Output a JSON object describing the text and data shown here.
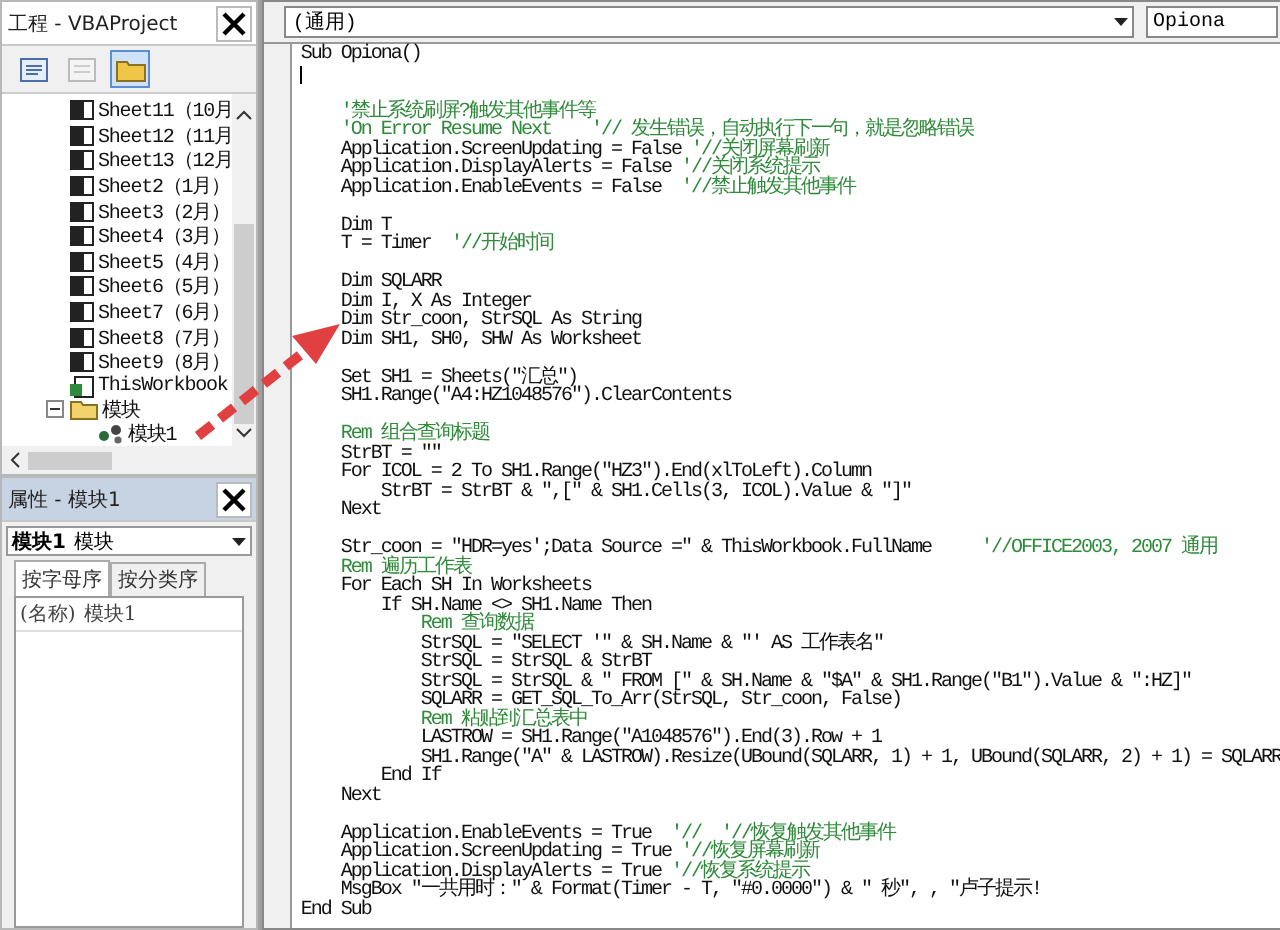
{
  "project_pane": {
    "title": "工程 - VBAProject",
    "toolbar": [
      {
        "kind": "view-code",
        "selected": false
      },
      {
        "kind": "view-object",
        "selected": false
      },
      {
        "kind": "toggle-folders",
        "selected": true
      }
    ],
    "tree": [
      {
        "kind": "sheet",
        "label": "Sheet11（10月"
      },
      {
        "kind": "sheet",
        "label": "Sheet12（11月"
      },
      {
        "kind": "sheet",
        "label": "Sheet13（12月"
      },
      {
        "kind": "sheet",
        "label": "Sheet2（1月）"
      },
      {
        "kind": "sheet",
        "label": "Sheet3（2月）"
      },
      {
        "kind": "sheet",
        "label": "Sheet4（3月）"
      },
      {
        "kind": "sheet",
        "label": "Sheet5（4月）"
      },
      {
        "kind": "sheet",
        "label": "Sheet6（5月）"
      },
      {
        "kind": "sheet",
        "label": "Sheet7（6月）"
      },
      {
        "kind": "sheet",
        "label": "Sheet8（7月）"
      },
      {
        "kind": "sheet",
        "label": "Sheet9（8月）"
      },
      {
        "kind": "workbook",
        "label": "ThisWorkbook"
      },
      {
        "kind": "folder",
        "label": "模块",
        "expanded": true,
        "children": [
          {
            "kind": "module",
            "label": "模块1"
          }
        ]
      }
    ]
  },
  "properties_pane": {
    "title": "属性 - 模块1",
    "object_name": "模块1",
    "object_type": "模块",
    "tabs": [
      {
        "label": "按字母序",
        "selected": true
      },
      {
        "label": "按分类序",
        "selected": false
      }
    ],
    "rows": [
      {
        "name": "(名称)",
        "value": "模块1"
      }
    ]
  },
  "code_window": {
    "object_combo": "(通用)",
    "procedure_combo": "Opiona",
    "lines": [
      {
        "kind": "text",
        "code": "Sub Opiona()"
      },
      {
        "kind": "cursor"
      },
      {
        "kind": "blank"
      },
      {
        "kind": "text",
        "comment": "    '禁止系统刷屏?触发其他事件等"
      },
      {
        "kind": "text",
        "comment": "    'On Error Resume Next    '// 发生错误，自动执行下一句，就是忽略错误"
      },
      {
        "kind": "text",
        "code": "    Application.ScreenUpdating = False ",
        "comment": "'//关闭屏幕刷新"
      },
      {
        "kind": "text",
        "code": "    Application.DisplayAlerts = False ",
        "comment": "'//关闭系统提示"
      },
      {
        "kind": "text",
        "code": "    Application.EnableEvents = False  ",
        "comment": "'//禁止触发其他事件"
      },
      {
        "kind": "blank"
      },
      {
        "kind": "text",
        "code": "    Dim T"
      },
      {
        "kind": "text",
        "code": "    T = Timer  ",
        "comment": "'//开始时间"
      },
      {
        "kind": "blank"
      },
      {
        "kind": "text",
        "code": "    Dim SQLARR"
      },
      {
        "kind": "text",
        "code": "    Dim I, X As Integer"
      },
      {
        "kind": "text",
        "code": "    Dim Str_coon, StrSQL As String"
      },
      {
        "kind": "text",
        "code": "    Dim SH1, SH0, SHW As Worksheet"
      },
      {
        "kind": "blank"
      },
      {
        "kind": "text",
        "code": "    Set SH1 = Sheets(\"汇总\")"
      },
      {
        "kind": "text",
        "code": "    SH1.Range(\"A4:HZ1048576\").ClearContents"
      },
      {
        "kind": "blank"
      },
      {
        "kind": "text",
        "comment": "    Rem 组合查询标题"
      },
      {
        "kind": "text",
        "code": "    StrBT = \"\""
      },
      {
        "kind": "text",
        "code": "    For ICOL = 2 To SH1.Range(\"HZ3\").End(xlToLeft).Column"
      },
      {
        "kind": "text",
        "code": "        StrBT = StrBT & \",[\" & SH1.Cells(3, ICOL).Value & \"]\""
      },
      {
        "kind": "text",
        "code": "    Next"
      },
      {
        "kind": "blank"
      },
      {
        "kind": "text",
        "code": "    Str_coon = \"HDR=yes';Data Source =\" & ThisWorkbook.FullName     ",
        "comment": "'//OFFICE2003, 2007 通用"
      },
      {
        "kind": "text",
        "comment": "    Rem 遍历工作表"
      },
      {
        "kind": "text",
        "code": "    For Each SH In Worksheets"
      },
      {
        "kind": "text",
        "code": "        If SH.Name <> SH1.Name Then"
      },
      {
        "kind": "text",
        "comment": "            Rem 查询数据"
      },
      {
        "kind": "text",
        "code": "            StrSQL = \"SELECT '\" & SH.Name & \"' AS 工作表名\""
      },
      {
        "kind": "text",
        "code": "            StrSQL = StrSQL & StrBT"
      },
      {
        "kind": "text",
        "code": "            StrSQL = StrSQL & \" FROM [\" & SH.Name & \"$A\" & SH1.Range(\"B1\").Value & \":HZ]\""
      },
      {
        "kind": "text",
        "code": "            SQLARR = GET_SQL_To_Arr(StrSQL, Str_coon, False)"
      },
      {
        "kind": "text",
        "comment": "            Rem 粘贴到汇总表中"
      },
      {
        "kind": "text",
        "code": "            LASTROW = SH1.Range(\"A1048576\").End(3).Row + 1"
      },
      {
        "kind": "text",
        "code": "            SH1.Range(\"A\" & LASTROW).Resize(UBound(SQLARR, 1) + 1, UBound(SQLARR, 2) + 1) = SQLARR"
      },
      {
        "kind": "text",
        "code": "        End If"
      },
      {
        "kind": "text",
        "code": "    Next"
      },
      {
        "kind": "blank"
      },
      {
        "kind": "text",
        "code": "    Application.EnableEvents = True  ",
        "comment": "'//  '//恢复触发其他事件"
      },
      {
        "kind": "text",
        "code": "    Application.ScreenUpdating = True ",
        "comment": "'//恢复屏幕刷新"
      },
      {
        "kind": "text",
        "code": "    Application.DisplayAlerts = True ",
        "comment": "'//恢复系统提示"
      },
      {
        "kind": "text",
        "code": "    MsgBox \"一共用时：\" & Format(Timer - T, \"#0.0000\") & \" 秒\", , \"卢子提示!"
      },
      {
        "kind": "text",
        "code": "End Sub"
      }
    ]
  }
}
